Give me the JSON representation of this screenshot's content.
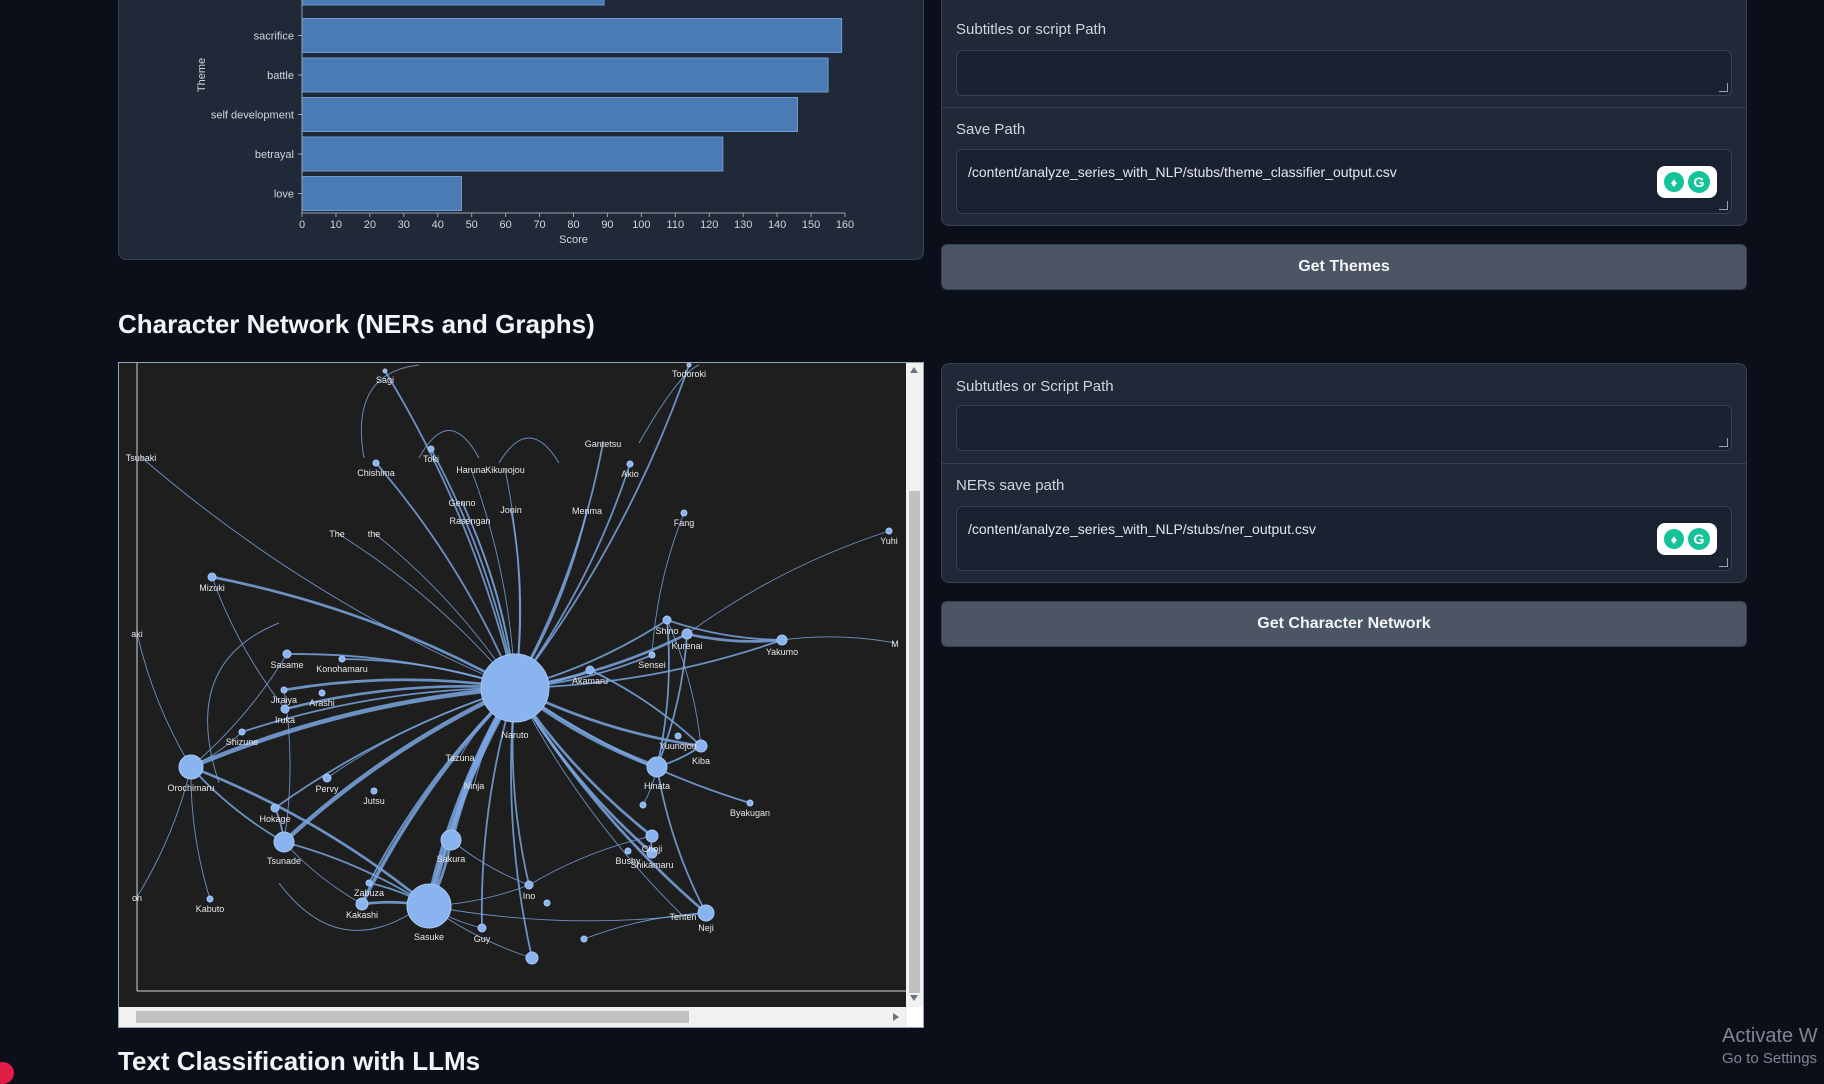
{
  "themes": {
    "chart_data": {
      "type": "bar",
      "orientation": "horizontal",
      "categories": [
        "sacrifice",
        "battle",
        "self development",
        "betrayal",
        "love"
      ],
      "values": [
        159,
        155,
        146,
        124,
        47
      ],
      "partial_top_bar_value": 89,
      "xlabel": "Score",
      "ylabel": "Theme",
      "xlim": [
        0,
        160
      ],
      "xticks": [
        "0",
        "10",
        "20",
        "30",
        "40",
        "50",
        "60",
        "70",
        "80",
        "90",
        "100",
        "110",
        "120",
        "130",
        "140",
        "150",
        "160"
      ],
      "bar_color": "#4a7bb5"
    },
    "subtitles_label": "Subtitles or script Path",
    "subtitles_value": "",
    "save_label": "Save Path",
    "save_value": "/content/analyze_series_with_NLP/stubs/theme_classifier_output.csv",
    "button_label": "Get Themes"
  },
  "network": {
    "title": "Character Network (NERs and Graphs)",
    "subtitles_label": "Subtutles or Script Path",
    "subtitles_value": "",
    "ners_label": "NERs save path",
    "ners_value": "/content/analyze_series_with_NLP/stubs/ner_output.csv",
    "button_label": "Get Character Network",
    "graph_labels": [
      "Sagi",
      "Todoroki",
      "Tsubaki",
      "Toki",
      "Chishima",
      "Haruna",
      "Kikunojou",
      "Gantetsu",
      "Akio",
      "Genno",
      "Jonin",
      "Rasengan",
      "Menma",
      "Fang",
      "The",
      "the",
      "Yuhi",
      "Mizuki",
      "Shino",
      "Kurenai",
      "Yakumo",
      "Sensei",
      "Akamaru",
      "aki",
      "Sasame",
      "Konohamaru",
      "Jiraiya",
      "Arashi",
      "Iruka",
      "Shizune",
      "Naruto",
      "Yuunojou",
      "Kiba",
      "Orochimaru",
      "Tazuna",
      "Ninja",
      "Hinata",
      "Pervy",
      "Jutsu",
      "Byakugan",
      "Hokage",
      "Tsunade",
      "Sakura",
      "Bushy",
      "Choji",
      "Shikamaru",
      "Zabuza",
      "Kakashi",
      "Ino",
      "Kabuto",
      "Sasuke",
      "Tenten",
      "Neji",
      "Guy",
      "on",
      "M"
    ]
  },
  "next_section_title": "Text Classification with LLMs",
  "windows_watermark": {
    "line1": "Activate W",
    "line2": "Go to Settings"
  },
  "colors": {
    "background": "#0b0f19",
    "panel": "#1f2937",
    "button": "#4b5563",
    "graph_bg": "#1e1e1e",
    "node": "#8ab4f0"
  },
  "icons": [
    "grammarly-bulb-icon",
    "grammarly-g-icon",
    "scroll-up-arrow-icon",
    "scroll-down-arrow-icon",
    "scroll-right-arrow-icon",
    "resize-handle-icon"
  ]
}
